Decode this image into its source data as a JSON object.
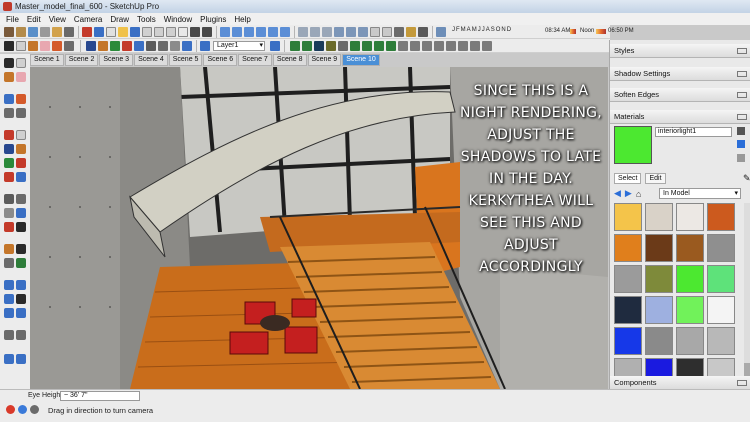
{
  "window": {
    "title": "Master_model_final_600 - SketchUp Pro"
  },
  "menu": [
    "File",
    "Edit",
    "View",
    "Camera",
    "Draw",
    "Tools",
    "Window",
    "Plugins",
    "Help"
  ],
  "shadow_toolbar": {
    "months": [
      "J",
      "F",
      "M",
      "A",
      "M",
      "J",
      "J",
      "A",
      "S",
      "O",
      "N",
      "D"
    ],
    "morning_time": "08:34 AM",
    "noon_label": "Noon",
    "evening_time": "06:50 PM"
  },
  "layers": {
    "current_layer": "Layer1"
  },
  "scenes": [
    "Scene 1",
    "Scene 2",
    "Scene 3",
    "Scene 4",
    "Scene 5",
    "Scene 6",
    "Scene 7",
    "Scene 8",
    "Scene 9",
    "Scene 10"
  ],
  "active_scene": "Scene 10",
  "overlay": {
    "lines": [
      "SINCE THIS IS A",
      "NIGHT RENDERING,",
      "ADJUST THE",
      "SHADOWS TO LATE",
      "IN THE DAY.",
      "KERKYTHEA WILL",
      "SEE THIS AND",
      "ADJUST",
      "ACCORDINGLY"
    ]
  },
  "panels": {
    "styles": "Styles",
    "shadow_settings": "Shadow Settings",
    "soften_edges": "Soften Edges",
    "materials": "Materials",
    "components": "Components"
  },
  "materials": {
    "current_name": "interiorlight1",
    "tab_select": "Select",
    "tab_edit": "Edit",
    "collection": "In Model",
    "swatches": [
      "#f4c44a",
      "#d9d2c8",
      "#ece8e4",
      "#cc5a1e",
      "#e07f1c",
      "#6b3a18",
      "#9a5a1f",
      "#8f8f8f",
      "#9b9b9b",
      "#7e8a3a",
      "#4ce830",
      "#5ee27a",
      "#1f2b3f",
      "#9eb0e0",
      "#71f25a",
      "#f4f4f4",
      "#1638e8",
      "#8a8a8a",
      "#a8a8a8",
      "#b8b8b8",
      "#b0b0b0",
      "#1a1ae0",
      "#2e2e2e",
      "#c8c8c8"
    ]
  },
  "status": {
    "eye_height_label": "Eye Height",
    "eye_height_value": "~ 36' 7\"",
    "hint": "Drag in direction to turn camera"
  },
  "colors": {
    "accent": "#4a8fd6",
    "selected_material": "#4ce830"
  }
}
